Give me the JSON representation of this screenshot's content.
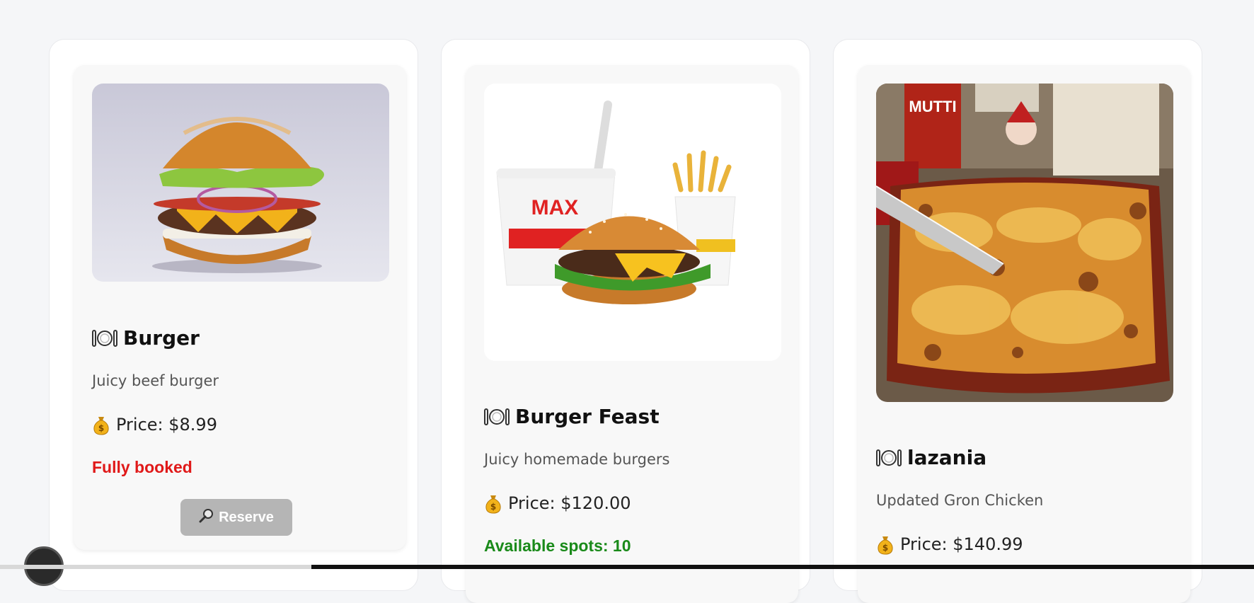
{
  "cards": [
    {
      "name": "Burger",
      "description": "Juicy beef burger",
      "price_text": "Price: $8.99",
      "status": "Fully booked",
      "status_color": "#e01919",
      "button_label": "Reserve",
      "button_icon": "magnifier-icon"
    },
    {
      "name": "Burger Feast",
      "description": "Juicy homemade burgers",
      "price_text": "Price: $120.00",
      "status": "Available spots: 10",
      "status_color": "#1a8a1a"
    },
    {
      "name": "lazania",
      "description": "Updated Gron Chicken",
      "price_text": "Price: $140.99"
    }
  ],
  "icons": {
    "title": "plate-cutlery-icon",
    "price": "money-bag-icon"
  },
  "colors": {
    "button_bg": "#b5b5b5",
    "page_bg": "#f5f6f8"
  }
}
